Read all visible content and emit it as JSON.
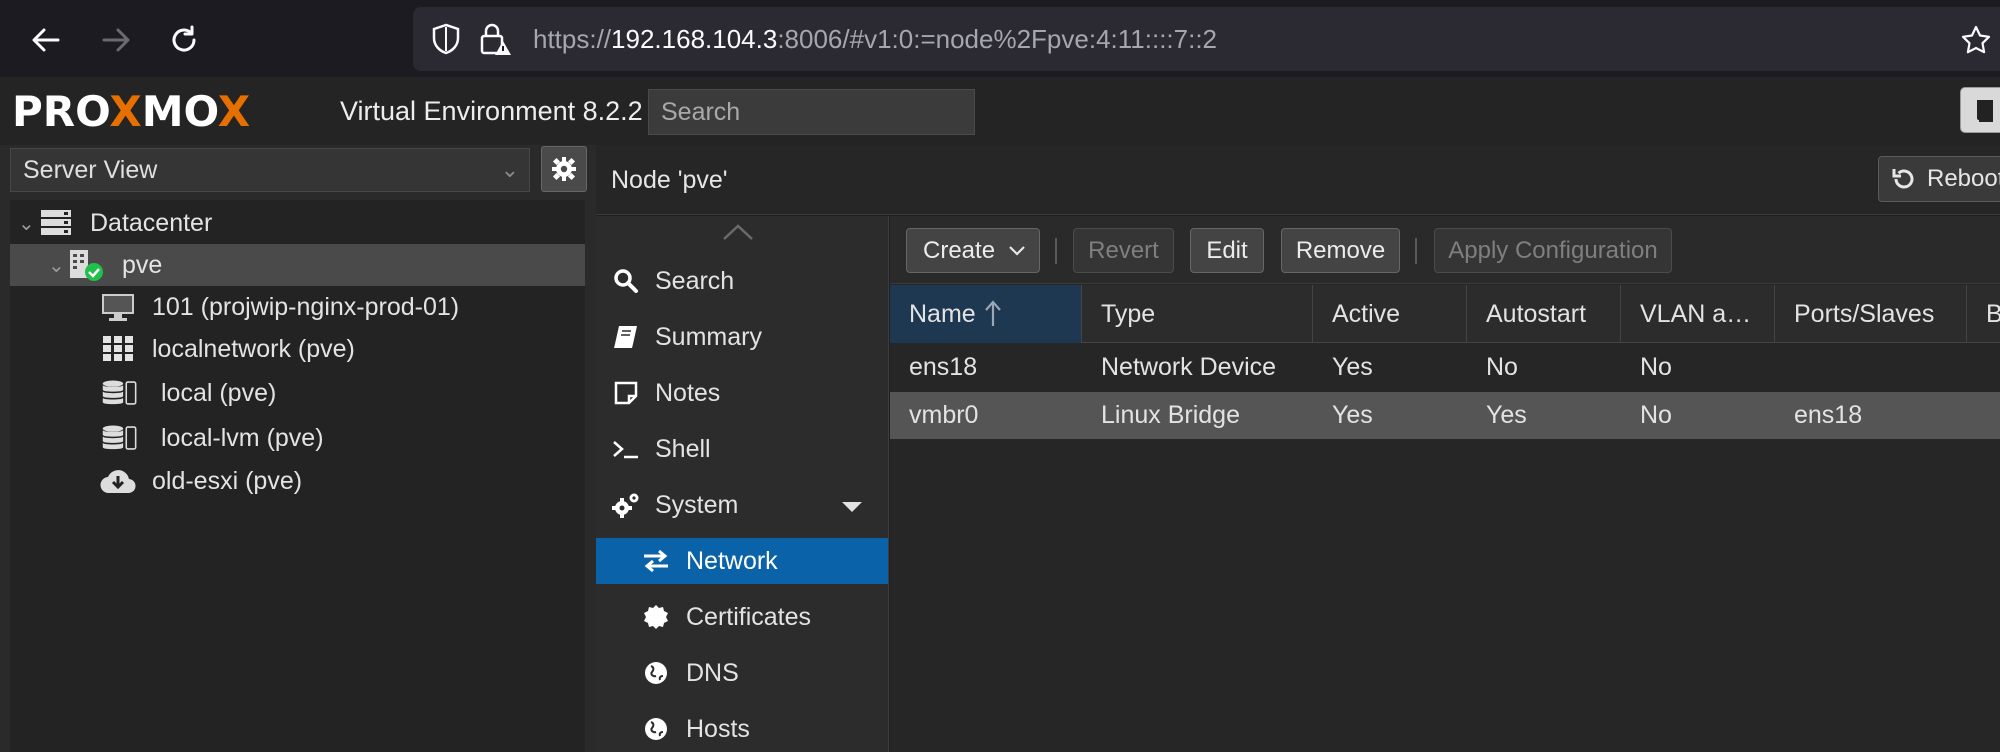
{
  "browser": {
    "url_prefix": "https://",
    "url_host": "192.168.104.3",
    "url_rest": ":8006/#v1:0:=node%2Fpve:4:11::::7::2"
  },
  "header": {
    "logo_text": "PROXMOX",
    "product": "Virtual Environment 8.2.2",
    "search_placeholder": "Search"
  },
  "sidebar": {
    "view": "Server View",
    "tree": [
      {
        "label": "Datacenter",
        "icon": "server-icon"
      },
      {
        "label": "pve",
        "icon": "node-online-icon"
      },
      {
        "label": "101 (projwip-nginx-prod-01)",
        "icon": "monitor-icon"
      },
      {
        "label": "localnetwork (pve)",
        "icon": "grid-icon"
      },
      {
        "label": "local (pve)",
        "icon": "storage-icon"
      },
      {
        "label": "local-lvm (pve)",
        "icon": "storage-icon"
      },
      {
        "label": "old-esxi (pve)",
        "icon": "cloud-download-icon"
      }
    ]
  },
  "node": {
    "title": "Node 'pve'",
    "reboot_label": "Reboot"
  },
  "menu": {
    "items": [
      {
        "label": "Search",
        "icon": "search-icon"
      },
      {
        "label": "Summary",
        "icon": "book-icon"
      },
      {
        "label": "Notes",
        "icon": "note-icon"
      },
      {
        "label": "Shell",
        "icon": "terminal-icon"
      },
      {
        "label": "System",
        "icon": "cogs-icon"
      },
      {
        "label": "Network",
        "icon": "exchange-icon"
      },
      {
        "label": "Certificates",
        "icon": "certificate-icon"
      },
      {
        "label": "DNS",
        "icon": "globe-icon"
      },
      {
        "label": "Hosts",
        "icon": "globe-icon"
      }
    ]
  },
  "toolbar": {
    "create": "Create",
    "revert": "Revert",
    "edit": "Edit",
    "remove": "Remove",
    "apply": "Apply Configuration"
  },
  "grid": {
    "columns": [
      "Name",
      "Type",
      "Active",
      "Autostart",
      "VLAN a…",
      "Ports/Slaves",
      "B"
    ],
    "rows": [
      [
        "ens18",
        "Network Device",
        "Yes",
        "No",
        "No",
        ""
      ],
      [
        "vmbr0",
        "Linux Bridge",
        "Yes",
        "Yes",
        "No",
        "ens18"
      ]
    ]
  },
  "colors": {
    "accent": "#0a63a8",
    "logo_orange": "#e57000",
    "status_green": "#21bf4b"
  }
}
